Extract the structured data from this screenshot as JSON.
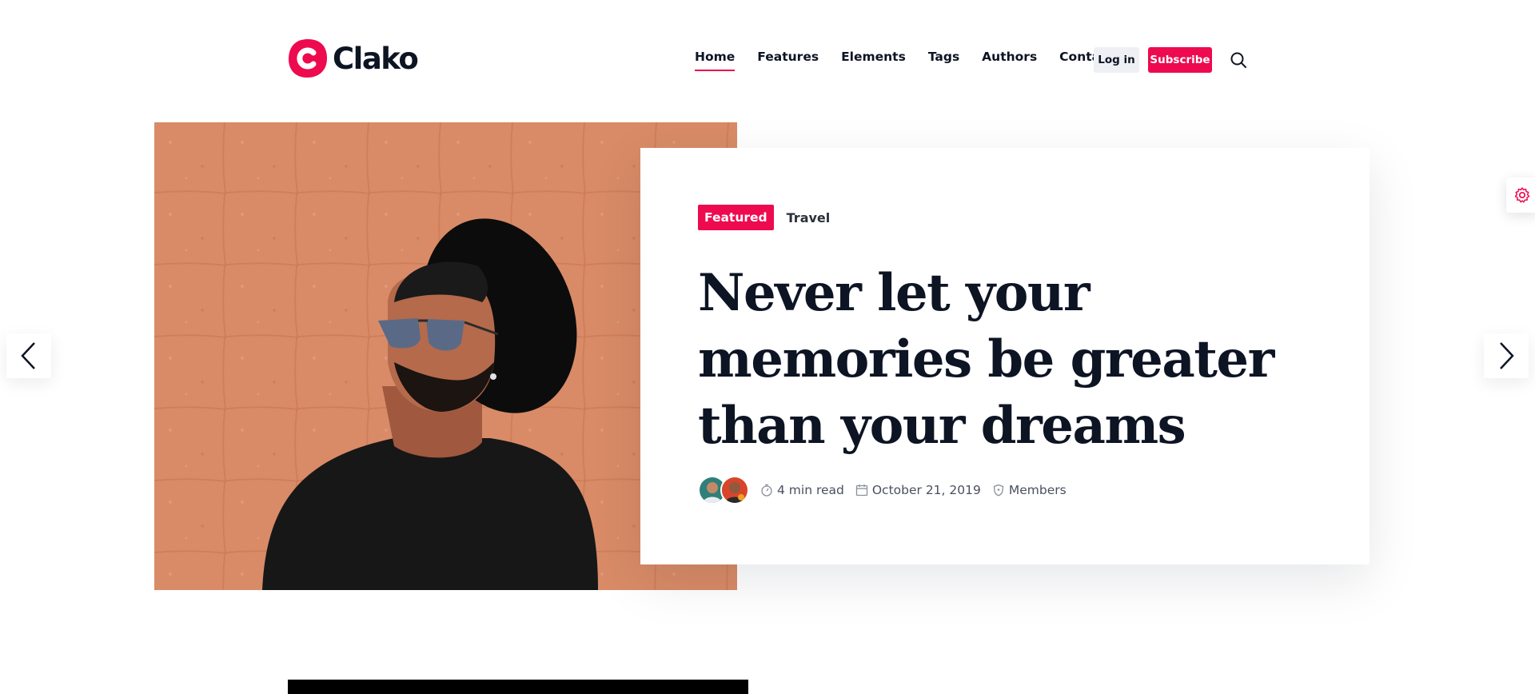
{
  "header": {
    "logo_text": "Clako",
    "nav": [
      {
        "label": "Home",
        "active": true
      },
      {
        "label": "Features",
        "active": false
      },
      {
        "label": "Elements",
        "active": false
      },
      {
        "label": "Tags",
        "active": false
      },
      {
        "label": "Authors",
        "active": false
      },
      {
        "label": "Contact",
        "active": false
      }
    ],
    "login_label": "Log in",
    "subscribe_label": "Subscribe"
  },
  "hero": {
    "tags": {
      "primary": "Featured",
      "secondary": "Travel"
    },
    "title": "Never let your memories be greater than your dreams",
    "meta": {
      "read_time": "4 min read",
      "date": "October 21, 2019",
      "access": "Members"
    }
  },
  "colors": {
    "accent": "#ee0a4f",
    "text": "#0d1423",
    "hero_bg": "#d98b67"
  },
  "icons": [
    "logo-c-icon",
    "search-icon",
    "chevron-left-icon",
    "chevron-right-icon",
    "gear-icon",
    "stopwatch-icon",
    "calendar-icon",
    "shield-icon"
  ]
}
